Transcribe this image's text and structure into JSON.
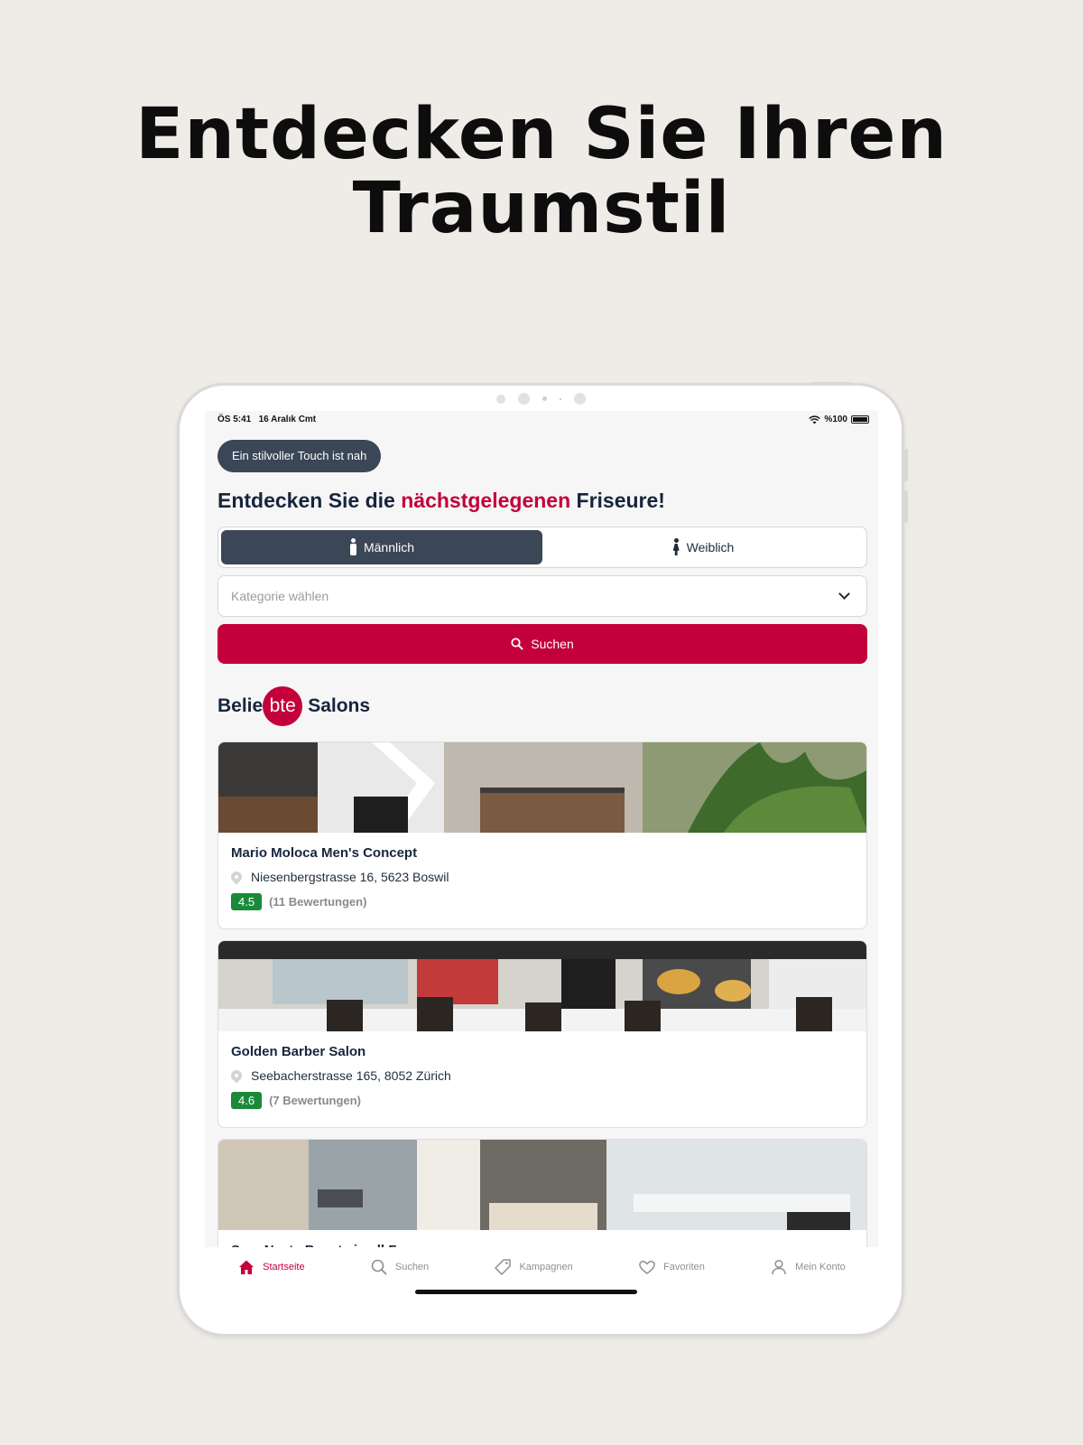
{
  "headline": {
    "line1": "Entdecken Sie Ihren",
    "line2": "Traumstil"
  },
  "statusbar": {
    "time": "ÖS 5:41",
    "date": "16 Aralık Cmt",
    "battery": "%100"
  },
  "pill": "Ein stilvoller Touch ist nah",
  "title": {
    "before": "Entdecken Sie die ",
    "accent": "nächstgelegenen",
    "after": " Friseure!"
  },
  "gender": {
    "male": "Männlich",
    "female": "Weiblich",
    "selected": "male"
  },
  "category": {
    "placeholder": "Kategorie wählen"
  },
  "search_button": "Suchen",
  "section": {
    "part1": "Belie",
    "part2": "bte",
    "part3": "Salons"
  },
  "salons": [
    {
      "name": "Mario Moloca Men's Concept",
      "address": "Niesenbergstrasse 16, 5623 Boswil",
      "rating": "4.5",
      "reviews": "(11 Bewertungen)"
    },
    {
      "name": "Golden Barber Salon",
      "address": "Seebacherstrasse 165, 8052 Zürich",
      "rating": "4.6",
      "reviews": "(7 Bewertungen)"
    },
    {
      "name": "Sara Nesta Beauty in all Form",
      "address": "",
      "rating": "",
      "reviews": ""
    }
  ],
  "tabbar": [
    {
      "label": "Startseite",
      "icon": "home-icon",
      "active": true
    },
    {
      "label": "Suchen",
      "icon": "search-icon",
      "active": false
    },
    {
      "label": "Kampagnen",
      "icon": "tag-icon",
      "active": false
    },
    {
      "label": "Favoriten",
      "icon": "heart-icon",
      "active": false
    },
    {
      "label": "Mein Konto",
      "icon": "user-icon",
      "active": false
    }
  ],
  "colors": {
    "accent": "#c3003a",
    "dark": "#3b4657",
    "rating_green": "#1a8a3a",
    "background": "#efece7"
  }
}
